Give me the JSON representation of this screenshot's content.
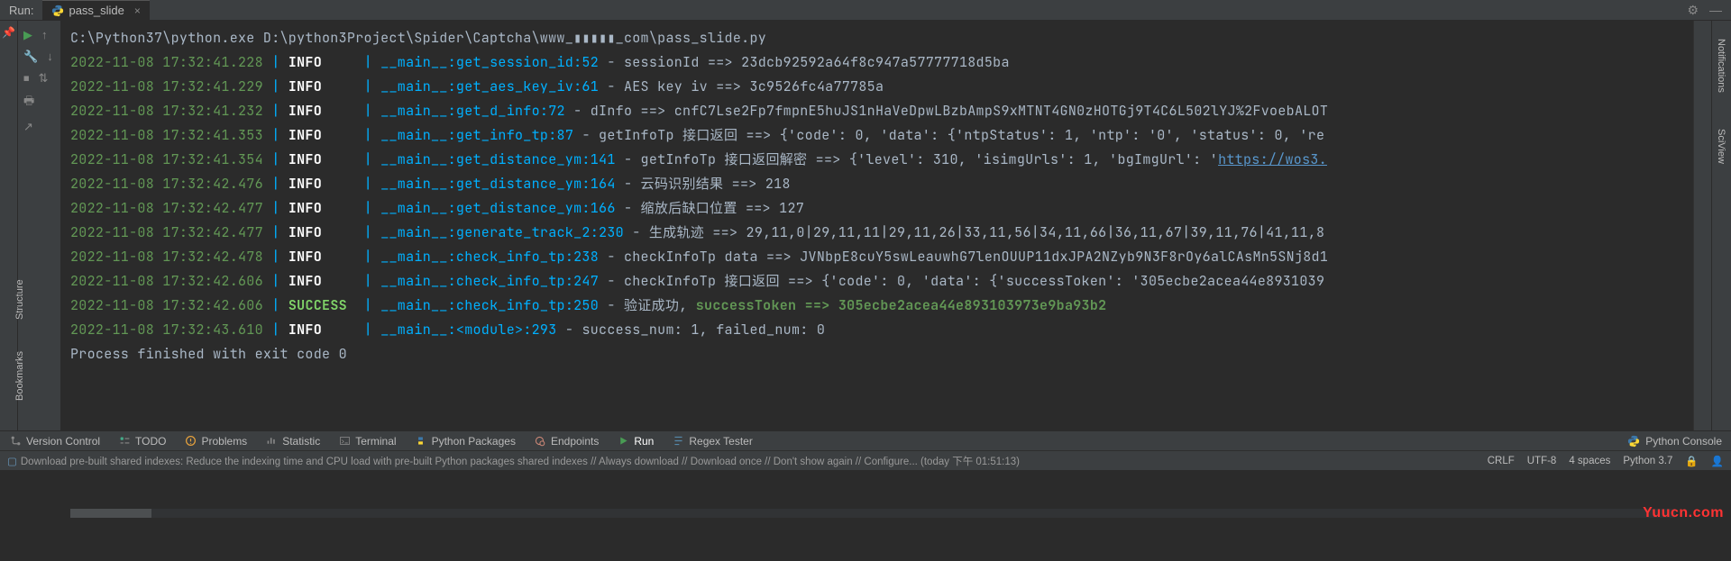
{
  "header": {
    "run_label": "Run:",
    "tab_name": "pass_slide",
    "close_glyph": "×"
  },
  "exec_line": "C:\\Python37\\python.exe D:\\python3Project\\Spider\\Captcha\\www_▮▮▮▮▮_com\\pass_slide.py",
  "logs": [
    {
      "ts": "2022-11-08 17:32:41.228",
      "lvl": "INFO",
      "mod": "__main__",
      "fn": "get_session_id",
      "ln": "52",
      "msg": "sessionId ==> 23dcb92592a64f8c947a57777718d5ba"
    },
    {
      "ts": "2022-11-08 17:32:41.229",
      "lvl": "INFO",
      "mod": "__main__",
      "fn": "get_aes_key_iv",
      "ln": "61",
      "msg": "AES key iv ==> 3c9526fc4a77785a"
    },
    {
      "ts": "2022-11-08 17:32:41.232",
      "lvl": "INFO",
      "mod": "__main__",
      "fn": "get_d_info",
      "ln": "72",
      "msg": "dInfo ==> cnfC7Lse2Fp7fmpnE5huJS1nHaVeDpwLBzbAmpS9xMTNT4GN0zHOTGj9T4C6L502lYJ%2FvoebALOT"
    },
    {
      "ts": "2022-11-08 17:32:41.353",
      "lvl": "INFO",
      "mod": "__main__",
      "fn": "get_info_tp",
      "ln": "87",
      "msg": "getInfoTp 接口返回 ==> {'code': 0, 'data': {'ntpStatus': 1, 'ntp': '0', 'status': 0, 're"
    },
    {
      "ts": "2022-11-08 17:32:41.354",
      "lvl": "INFO",
      "mod": "__main__",
      "fn": "get_distance_ym",
      "ln": "141",
      "msg": "getInfoTp 接口返回解密 ==> {'level': 310, 'isimgUrls': 1, 'bgImgUrl': '",
      "link": "https://wos3."
    },
    {
      "ts": "2022-11-08 17:32:42.476",
      "lvl": "INFO",
      "mod": "__main__",
      "fn": "get_distance_ym",
      "ln": "164",
      "msg": "云码识别结果 ==> 218"
    },
    {
      "ts": "2022-11-08 17:32:42.477",
      "lvl": "INFO",
      "mod": "__main__",
      "fn": "get_distance_ym",
      "ln": "166",
      "msg": "缩放后缺口位置 ==> 127"
    },
    {
      "ts": "2022-11-08 17:32:42.477",
      "lvl": "INFO",
      "mod": "__main__",
      "fn": "generate_track_2",
      "ln": "230",
      "msg": "生成轨迹 ==> 29,11,0|29,11,11|29,11,26|33,11,56|34,11,66|36,11,67|39,11,76|41,11,8"
    },
    {
      "ts": "2022-11-08 17:32:42.478",
      "lvl": "INFO",
      "mod": "__main__",
      "fn": "check_info_tp",
      "ln": "238",
      "msg": "checkInfoTp data ==> JVNbpE8cuY5swLeauwhG7lenOUUP11dxJPA2NZyb9N3F8rOy6alCAsMn5SNj8d1"
    },
    {
      "ts": "2022-11-08 17:32:42.606",
      "lvl": "INFO",
      "mod": "__main__",
      "fn": "check_info_tp",
      "ln": "247",
      "msg": "checkInfoTp 接口返回 ==> {'code': 0, 'data': {'successToken': '305ecbe2acea44e8931039"
    },
    {
      "ts": "2022-11-08 17:32:42.606",
      "lvl": "SUCCESS",
      "mod": "__main__",
      "fn": "check_info_tp",
      "ln": "250",
      "msg": "验证成功, ",
      "green": "successToken ==> 305ecbe2acea44e893103973e9ba93b2"
    },
    {
      "ts": "2022-11-08 17:32:43.610",
      "lvl": "INFO",
      "mod": "__main__",
      "fn": "<module>",
      "ln": "293",
      "msg": "success_num: 1, failed_num: 0"
    }
  ],
  "finish": "Process finished with exit code 0",
  "tools": {
    "version_control": "Version Control",
    "todo": "TODO",
    "problems": "Problems",
    "statistic": "Statistic",
    "terminal": "Terminal",
    "python_packages": "Python Packages",
    "endpoints": "Endpoints",
    "run": "Run",
    "regex_tester": "Regex Tester",
    "python_console": "Python Console"
  },
  "right_tabs": {
    "notifications": "Notifications",
    "sciview": "SciView"
  },
  "left_tabs": {
    "bookmarks": "Bookmarks",
    "structure": "Structure"
  },
  "status": {
    "msg": "Download pre-built shared indexes: Reduce the indexing time and CPU load with pre-built Python packages shared indexes // Always download // Download once // Don't show again // Configure... (today 下午 01:51:13)",
    "crlf": "CRLF",
    "encoding": "UTF-8",
    "spaces": "4 spaces",
    "python": "Python 3.7"
  },
  "watermark": "Yuucn.com"
}
